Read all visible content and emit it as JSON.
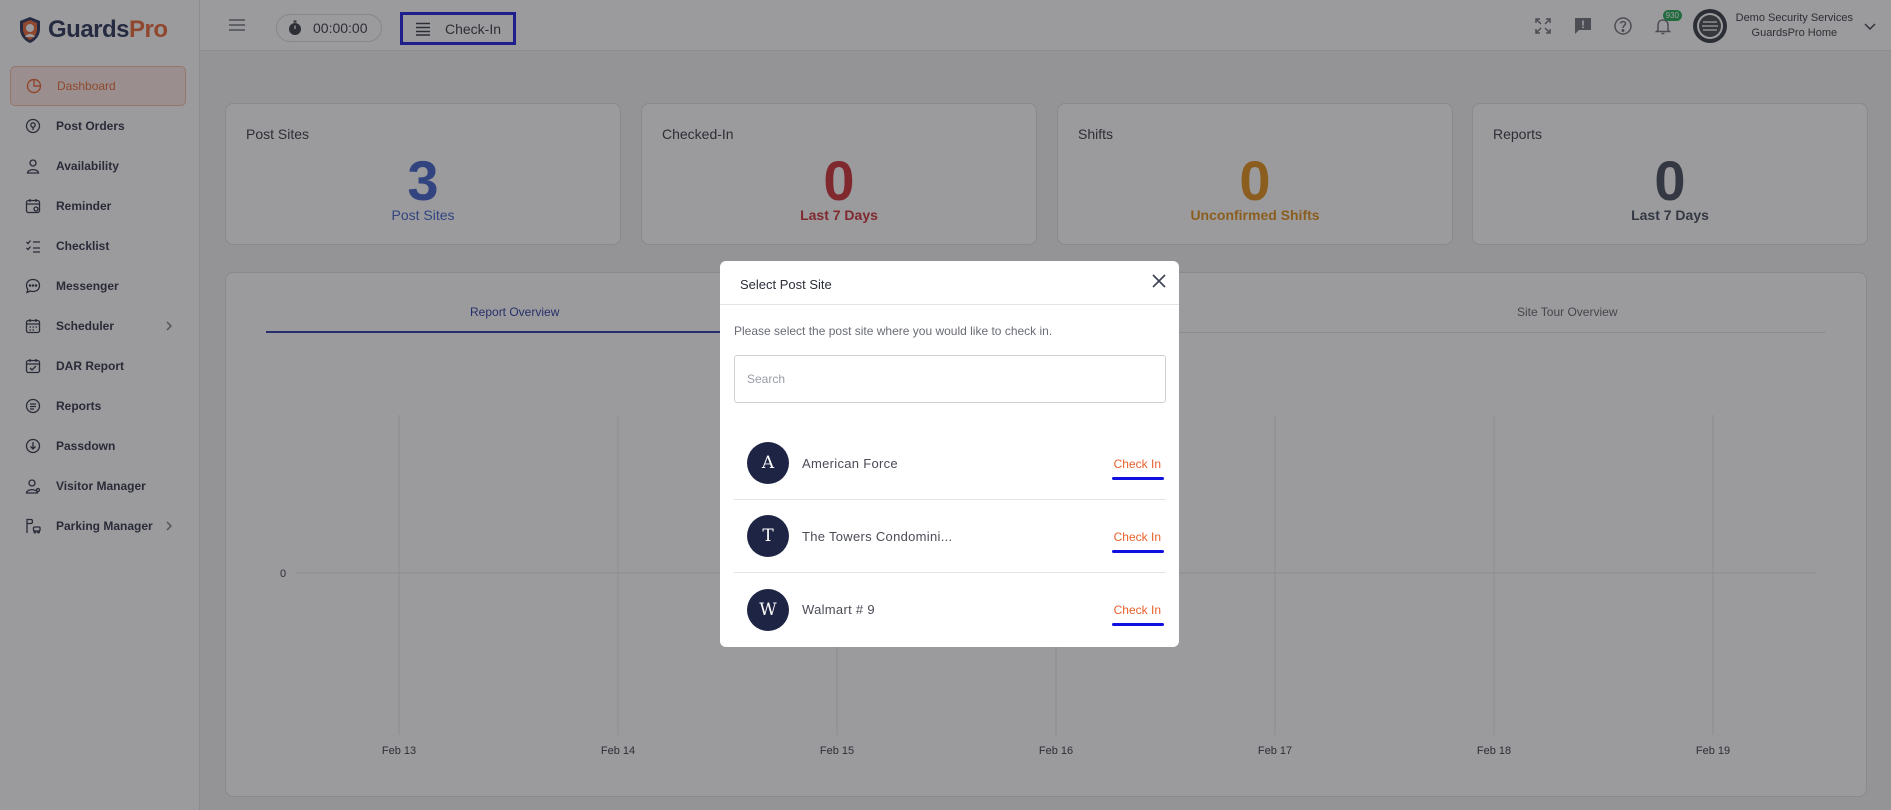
{
  "brand": {
    "part1": "Guards",
    "part2": "Pro"
  },
  "sidebar": {
    "items": [
      {
        "label": "Dashboard",
        "icon": "dashboard-icon"
      },
      {
        "label": "Post Orders",
        "icon": "post-orders-icon"
      },
      {
        "label": "Availability",
        "icon": "availability-icon"
      },
      {
        "label": "Reminder",
        "icon": "reminder-icon"
      },
      {
        "label": "Checklist",
        "icon": "checklist-icon"
      },
      {
        "label": "Messenger",
        "icon": "messenger-icon"
      },
      {
        "label": "Scheduler",
        "icon": "scheduler-icon"
      },
      {
        "label": "DAR Report",
        "icon": "dar-report-icon"
      },
      {
        "label": "Reports",
        "icon": "reports-icon"
      },
      {
        "label": "Passdown",
        "icon": "passdown-icon"
      },
      {
        "label": "Visitor Manager",
        "icon": "visitor-manager-icon"
      },
      {
        "label": "Parking Manager",
        "icon": "parking-manager-icon"
      }
    ]
  },
  "topbar": {
    "timer": "00:00:00",
    "checkin_label": "Check-In",
    "notification_count": "930",
    "company_name": "Demo Security Services",
    "company_sub": "GuardsPro Home"
  },
  "cards": [
    {
      "title": "Post Sites",
      "value": "3",
      "sub": "Post Sites",
      "color": "#3558c8"
    },
    {
      "title": "Checked-In",
      "value": "0",
      "sub": "Last 7 Days",
      "color": "#c9262c"
    },
    {
      "title": "Shifts",
      "value": "0",
      "sub": "Unconfirmed Shifts",
      "color": "#e08a10"
    },
    {
      "title": "Reports",
      "value": "0",
      "sub": "Last 7 Days",
      "color": "#3a4252"
    }
  ],
  "tabs": {
    "report_overview": "Report Overview",
    "site_tour_overview": "Site Tour Overview"
  },
  "chart_data": {
    "type": "line",
    "categories": [
      "Feb 13",
      "Feb 14",
      "Feb 15",
      "Feb 16",
      "Feb 17",
      "Feb 18",
      "Feb 19"
    ],
    "y_ticks": [
      "0"
    ],
    "values": [
      0,
      0,
      0,
      0,
      0,
      0,
      0
    ],
    "grid": true
  },
  "modal": {
    "title": "Select Post Site",
    "description": "Please select the post site where you would like to check in.",
    "search_placeholder": "Search",
    "sites": [
      {
        "initial": "A",
        "name": "American Force",
        "action": "Check In"
      },
      {
        "initial": "T",
        "name": "The Towers Condomini...",
        "action": "Check In"
      },
      {
        "initial": "W",
        "name": "Walmart # 9",
        "action": "Check In"
      }
    ]
  }
}
